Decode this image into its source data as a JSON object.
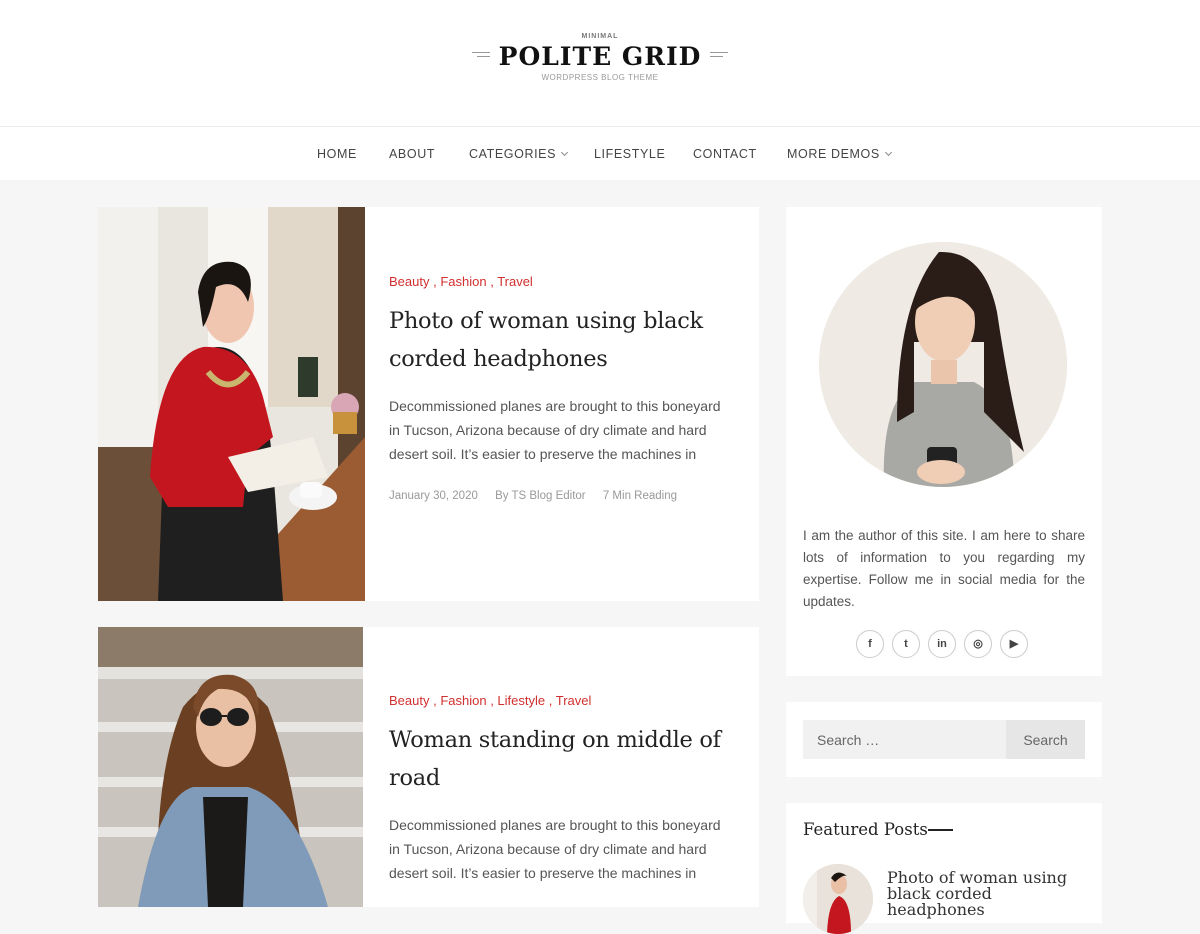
{
  "header": {
    "logo_tag": "MINIMAL",
    "logo_title": "POLITE GRID",
    "logo_sub": "WORDPRESS BLOG THEME"
  },
  "nav": {
    "items": [
      {
        "label": "HOME"
      },
      {
        "label": "ABOUT"
      },
      {
        "label": "CATEGORIES",
        "dropdown": true
      },
      {
        "label": "LIFESTYLE"
      },
      {
        "label": "CONTACT"
      },
      {
        "label": "MORE DEMOS",
        "dropdown": true
      }
    ]
  },
  "posts": [
    {
      "categories": [
        "Beauty",
        "Fashion",
        "Travel"
      ],
      "title": "Photo of woman using black corded headphones",
      "excerpt": "Decommissioned planes are brought to this boneyard in Tucson, Arizona because of dry climate and hard desert soil. It’s easier to preserve the machines in",
      "date": "January 30, 2020",
      "author": "By TS Blog Editor",
      "reading": "7 Min Reading"
    },
    {
      "categories": [
        "Beauty",
        "Fashion",
        "Lifestyle",
        "Travel"
      ],
      "title": "Woman standing on middle of road",
      "excerpt": "Decommissioned planes are brought to this boneyard in Tucson, Arizona because of dry climate and hard desert soil. It’s easier to preserve the machines in"
    }
  ],
  "sidebar": {
    "about_text": "I am the author of this site. I am here to share lots of information to you regarding my expertise. Follow me in social media for the updates.",
    "socials": [
      {
        "icon": "facebook-icon",
        "glyph": "f"
      },
      {
        "icon": "twitter-icon",
        "glyph": "t"
      },
      {
        "icon": "linkedin-icon",
        "glyph": "in"
      },
      {
        "icon": "instagram-icon",
        "glyph": "◎"
      },
      {
        "icon": "youtube-icon",
        "glyph": "▶"
      }
    ],
    "search": {
      "placeholder": "Search …",
      "button_label": "Search"
    },
    "featured": {
      "title": "Featured Posts",
      "items": [
        {
          "title": "Photo of woman using black corded headphones"
        }
      ]
    }
  },
  "colors": {
    "accent": "#d0302f",
    "background": "#f6f6f6",
    "card": "#ffffff"
  }
}
